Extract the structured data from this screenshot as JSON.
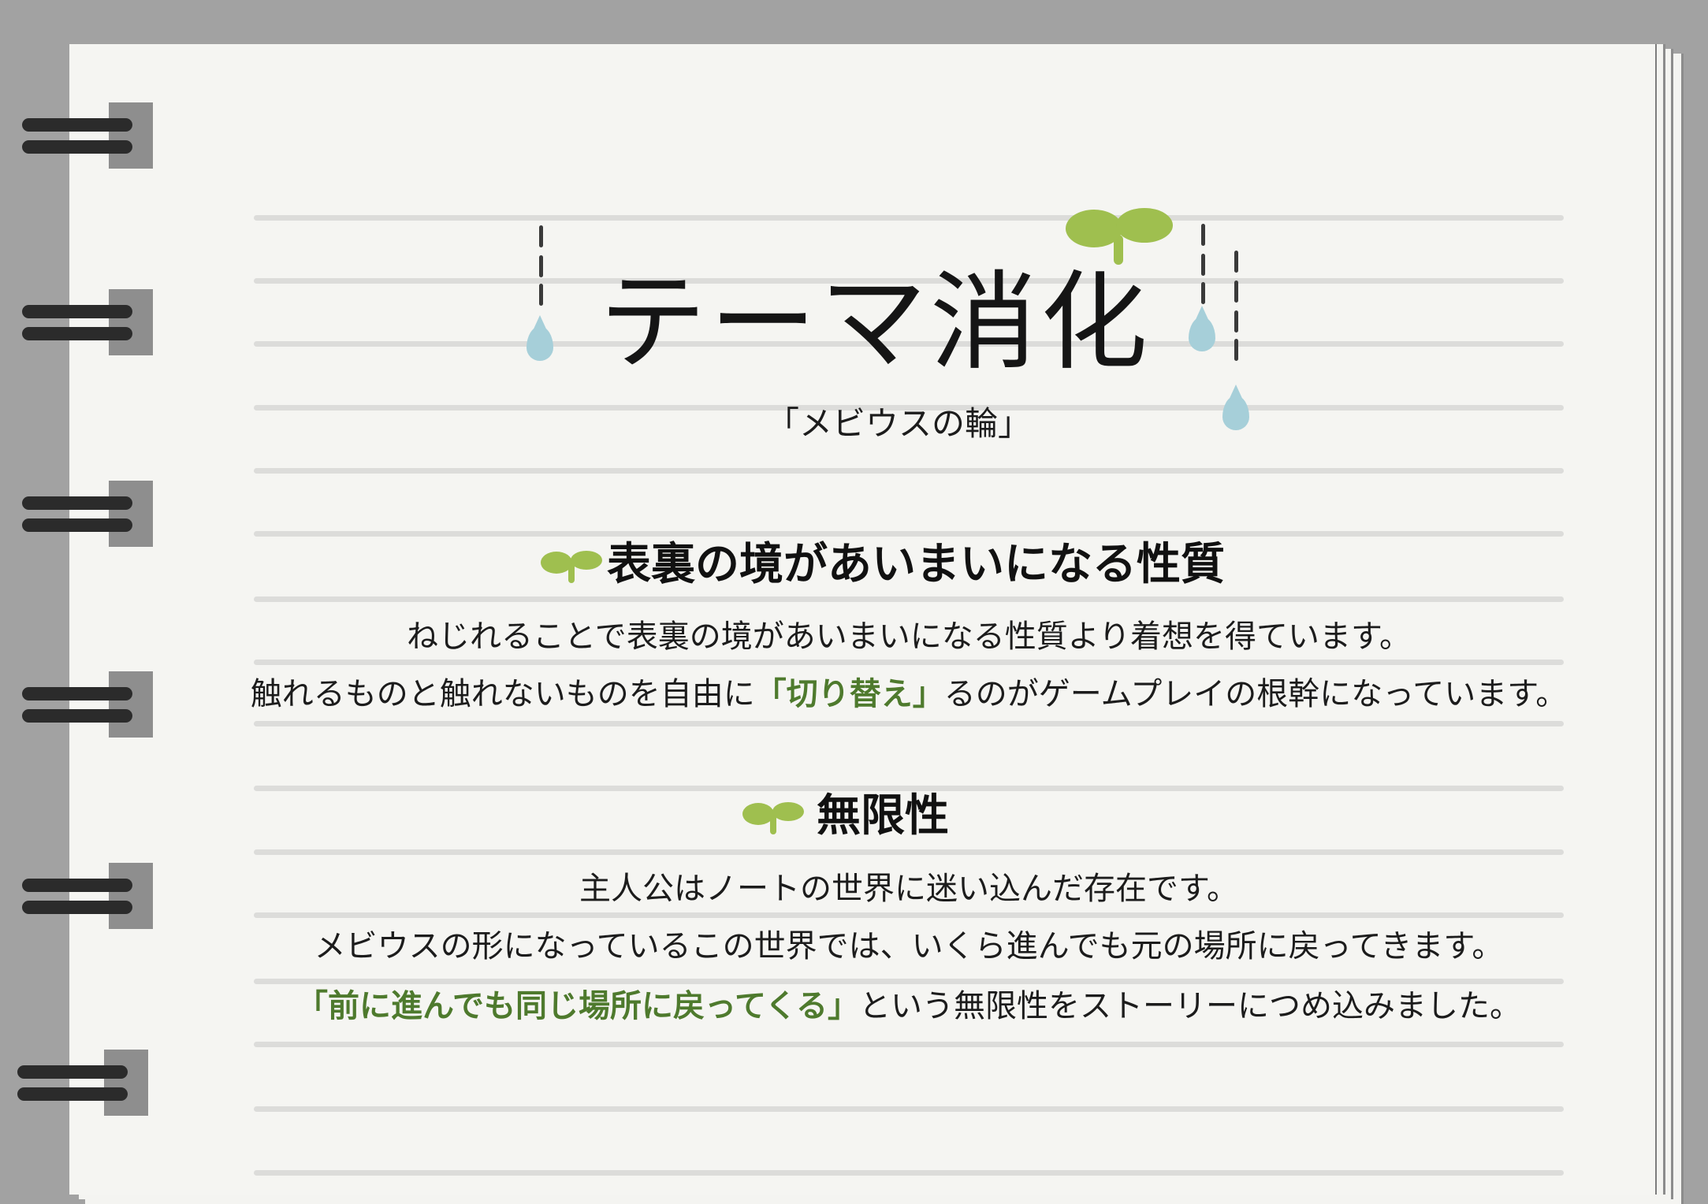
{
  "title": "テーマ消化",
  "subtitle": "「メビウスの輪」",
  "sections": [
    {
      "heading": "表裏の境があいまいになる性質",
      "line1": "ねじれることで表裏の境があいまいになる性質より着想を得ています。",
      "line2_before": "触れるものと触れないものを自由に",
      "line2_highlight": "「切り替え」",
      "line2_after": "るのがゲームプレイの根幹になっています。"
    },
    {
      "heading": "無限性",
      "line1": "主人公はノートの世界に迷い込んだ存在です。",
      "line2": "メビウスの形になっているこの世界では、いくら進んでも元の場所に戻ってきます。",
      "line3_highlight": "「前に進んでも同じ場所に戻ってくる」",
      "line3_after": "という無限性をストーリーにつめ込みました。"
    }
  ],
  "colors": {
    "background": "#a2a2a2",
    "paper": "#f5f5f2",
    "rule": "#dcdcda",
    "ring": "#2b2b2b",
    "sprout": "#9fbf4f",
    "drop": "#a6cfd9",
    "highlight": "#4e7a2d"
  },
  "icons": [
    "spiral-ring-icon",
    "sprout-icon",
    "water-drop-icon"
  ]
}
